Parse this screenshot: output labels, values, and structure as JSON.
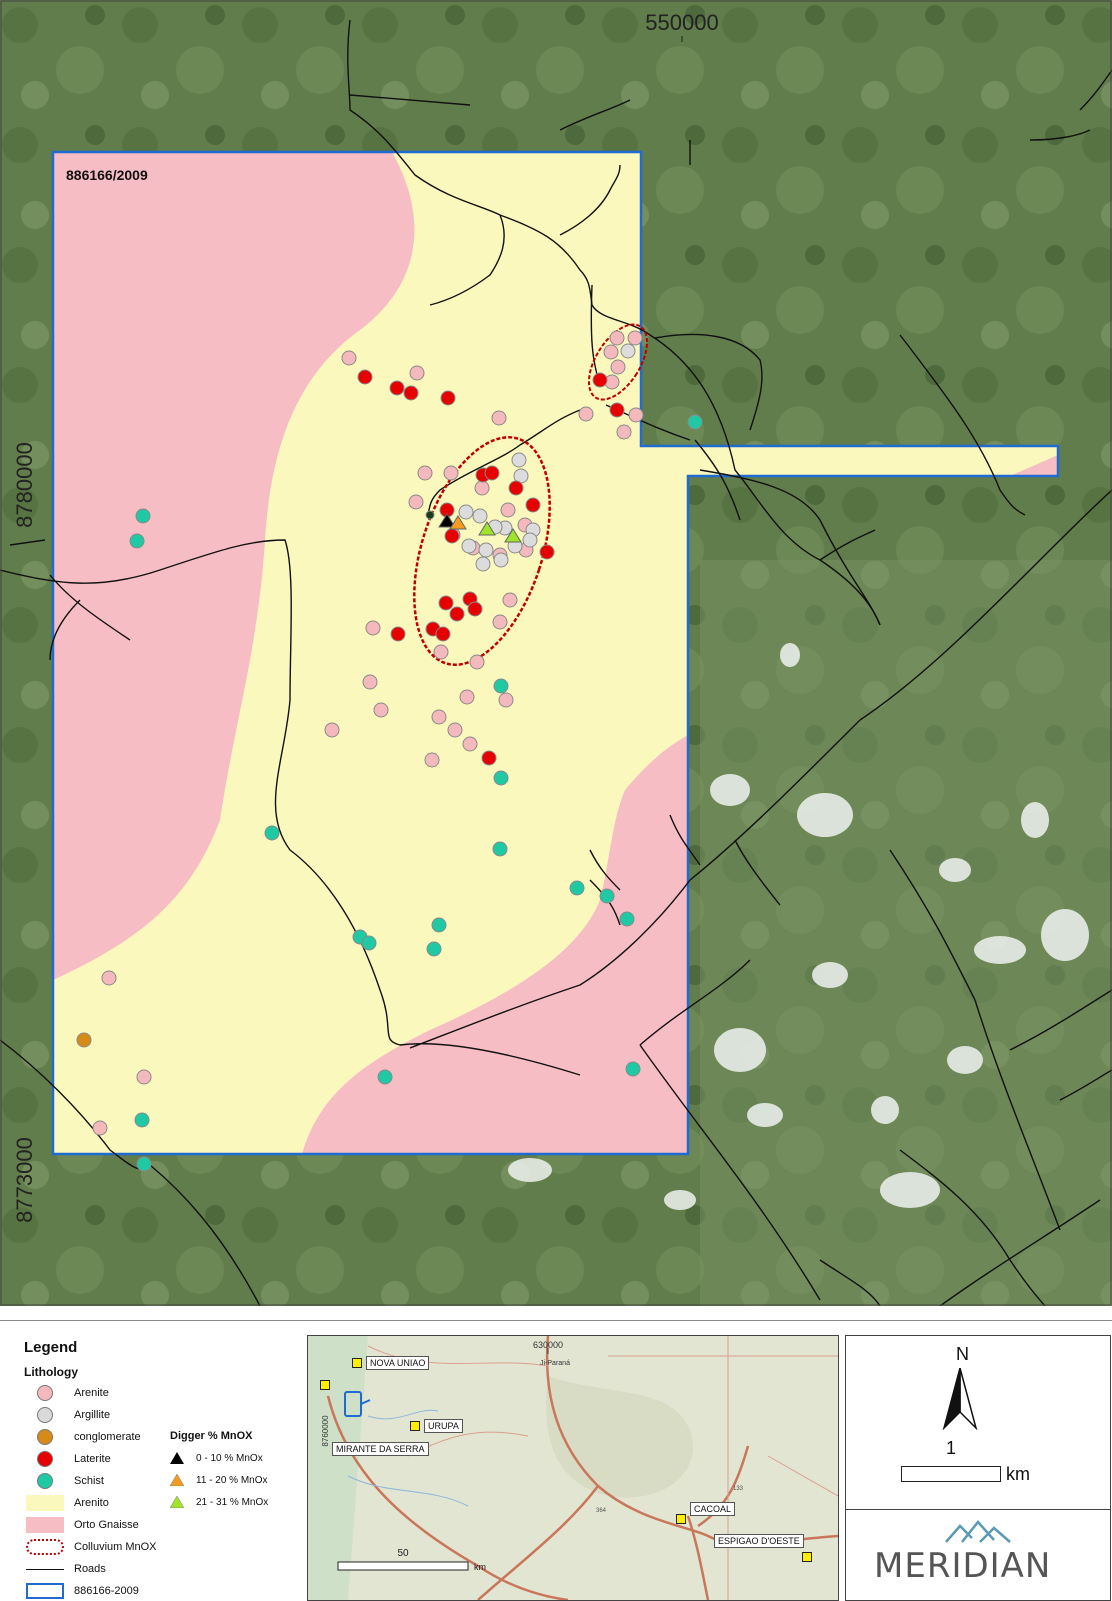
{
  "map": {
    "tenement_label": "886166/2009",
    "easting_tick": "550000",
    "northing_ticks": [
      "8780000",
      "8773000"
    ]
  },
  "legend": {
    "title": "Legend",
    "lithology_title": "Lithology",
    "lithology_items": [
      {
        "label": "Arenite",
        "color": "#f4b9bd"
      },
      {
        "label": "Argillite",
        "color": "#d9d9d9"
      },
      {
        "label": "conglomerate",
        "color": "#d68a17"
      },
      {
        "label": "Laterite",
        "color": "#e60000"
      },
      {
        "label": "Schist",
        "color": "#1ec9a4"
      }
    ],
    "area_items": [
      {
        "label": "Arenito",
        "color": "#fbf8bd"
      },
      {
        "label": "Orto Gnaisse",
        "color": "#f7bdc4"
      },
      {
        "label": "Colluvium MnOX",
        "color": "#c00000"
      },
      {
        "label": "Roads",
        "color": "#111111"
      },
      {
        "label": "886166-2009",
        "color": "#1f6bd1"
      }
    ],
    "digger_title": "Digger % MnOX",
    "digger_items": [
      {
        "label": "0 - 10 % MnOx",
        "color": "#000000"
      },
      {
        "label": "11 - 20 % MnOx",
        "color": "#f39c1f"
      },
      {
        "label": "21 - 31 % MnOx",
        "color": "#9fe32b"
      }
    ]
  },
  "inset": {
    "places": [
      "NOVA UNIAO",
      "URUPA",
      "MIRANTE DA SERRA",
      "CACOAL",
      "ESPIGAO D'OESTE"
    ],
    "tick_top": "630000",
    "tick_left": "8760000",
    "town_small": "Ji-Paraná",
    "road_labels": [
      "133",
      "364"
    ],
    "scale_value": "50",
    "scale_unit": "km"
  },
  "north": {
    "label": "N",
    "scale_value": "1",
    "scale_unit": "km"
  },
  "logo": {
    "text": "MERIDIAN"
  },
  "colors": {
    "arenito": "#fbf8bd",
    "gneiss": "#f7bdc4",
    "boundary": "#1f6bd1",
    "colluvium": "#c00000"
  }
}
